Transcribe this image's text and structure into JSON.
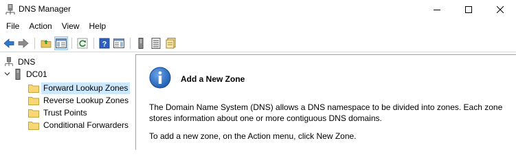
{
  "window": {
    "title": "DNS Manager"
  },
  "menu": {
    "items": [
      "File",
      "Action",
      "View",
      "Help"
    ]
  },
  "tree": {
    "root": "DNS",
    "server": "DC01",
    "zones": [
      "Forward Lookup Zones",
      "Reverse Lookup Zones",
      "Trust Points",
      "Conditional Forwarders"
    ],
    "selected": "Forward Lookup Zones"
  },
  "content": {
    "heading": "Add a New Zone",
    "description": "The Domain Name System (DNS) allows a DNS namespace to be divided into zones. Each zone stores information about one or more contiguous DNS domains.",
    "instruction": "To add a new zone, on the Action menu, click New Zone."
  },
  "colors": {
    "selection": "#cce8ff",
    "toolbar_active": "#cce4f7",
    "info_blue": "#1f5fb5",
    "folder": "#f7d774"
  }
}
